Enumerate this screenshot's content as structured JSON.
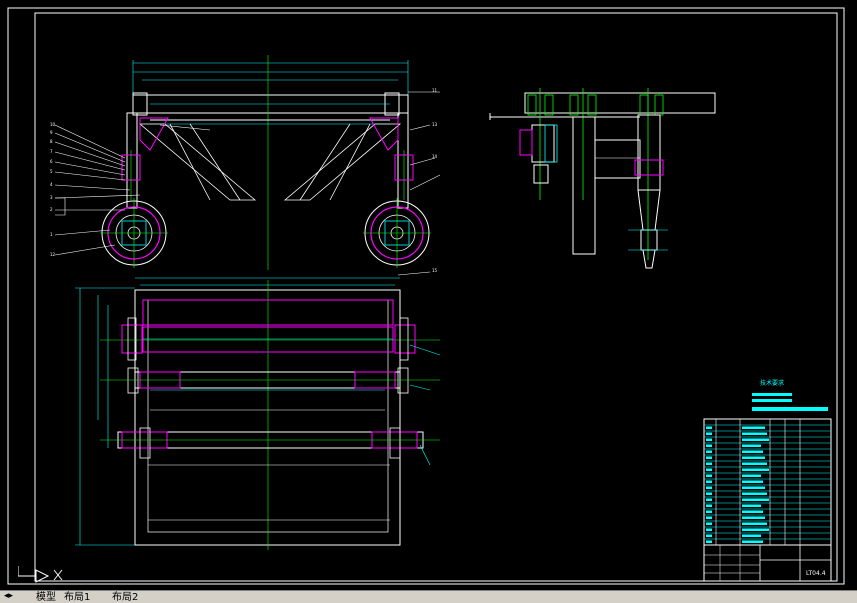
{
  "viewport": {
    "background": "#000000",
    "line_colors": {
      "frame": "#ffffff",
      "part": "#00ffff",
      "highlight": "#ff00ff",
      "centerline": "#00ff00",
      "dimension": "#00ffff",
      "title_block": "#00ffff",
      "balloon": "#ffffff"
    }
  },
  "parts_table": {
    "title": "技术要求",
    "drawing_code": "LT04.4"
  },
  "layout_tabs": {
    "model": "模型",
    "layout1": "布局1",
    "layout2": "布局2"
  },
  "icons": {
    "ucs": "ucs-axis-icon",
    "tab_nav": "tab-navigation-arrows-icon"
  }
}
